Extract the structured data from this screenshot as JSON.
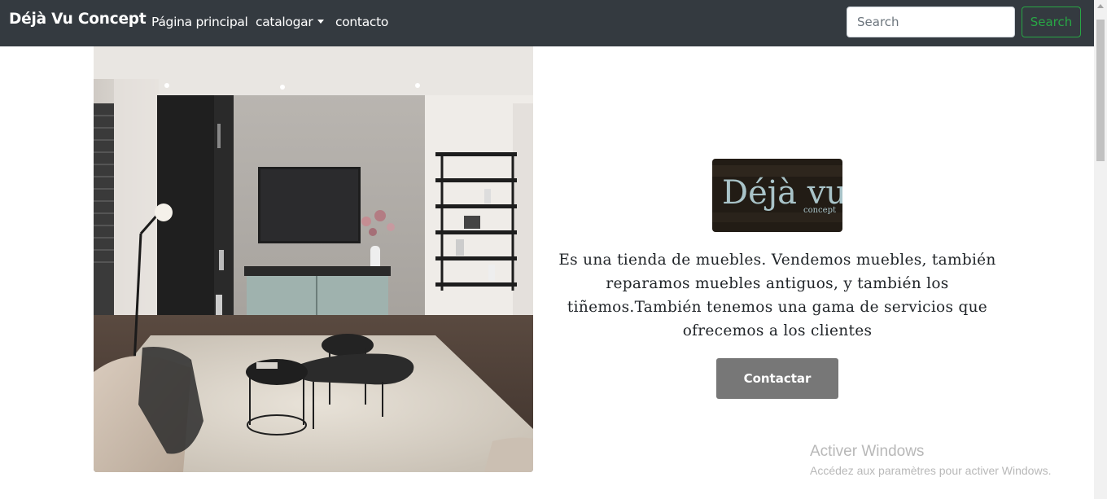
{
  "navbar": {
    "brand": "Déjà Vu Concept",
    "links": {
      "home": "Página principal",
      "catalog": "catalogar",
      "contact": "contacto"
    },
    "search": {
      "placeholder": "Search",
      "value": "",
      "button_label": "Search"
    }
  },
  "hero": {
    "logo": {
      "wordmark": "Déjà vu",
      "tagline": "concept"
    },
    "description": "Es una tienda de muebles. Vendemos muebles, también reparamos muebles antiguos, y también los tiñemos.También tenemos una gama de servicios que ofrecemos a los clientes",
    "contact_button": "Contactar"
  },
  "os_watermark": {
    "title": "Activer Windows",
    "subtitle": "Accédez aux paramètres pour activer Windows."
  },
  "colors": {
    "navbar_bg": "#343a40",
    "search_button": "#28a745",
    "contact_button": "#777777"
  }
}
